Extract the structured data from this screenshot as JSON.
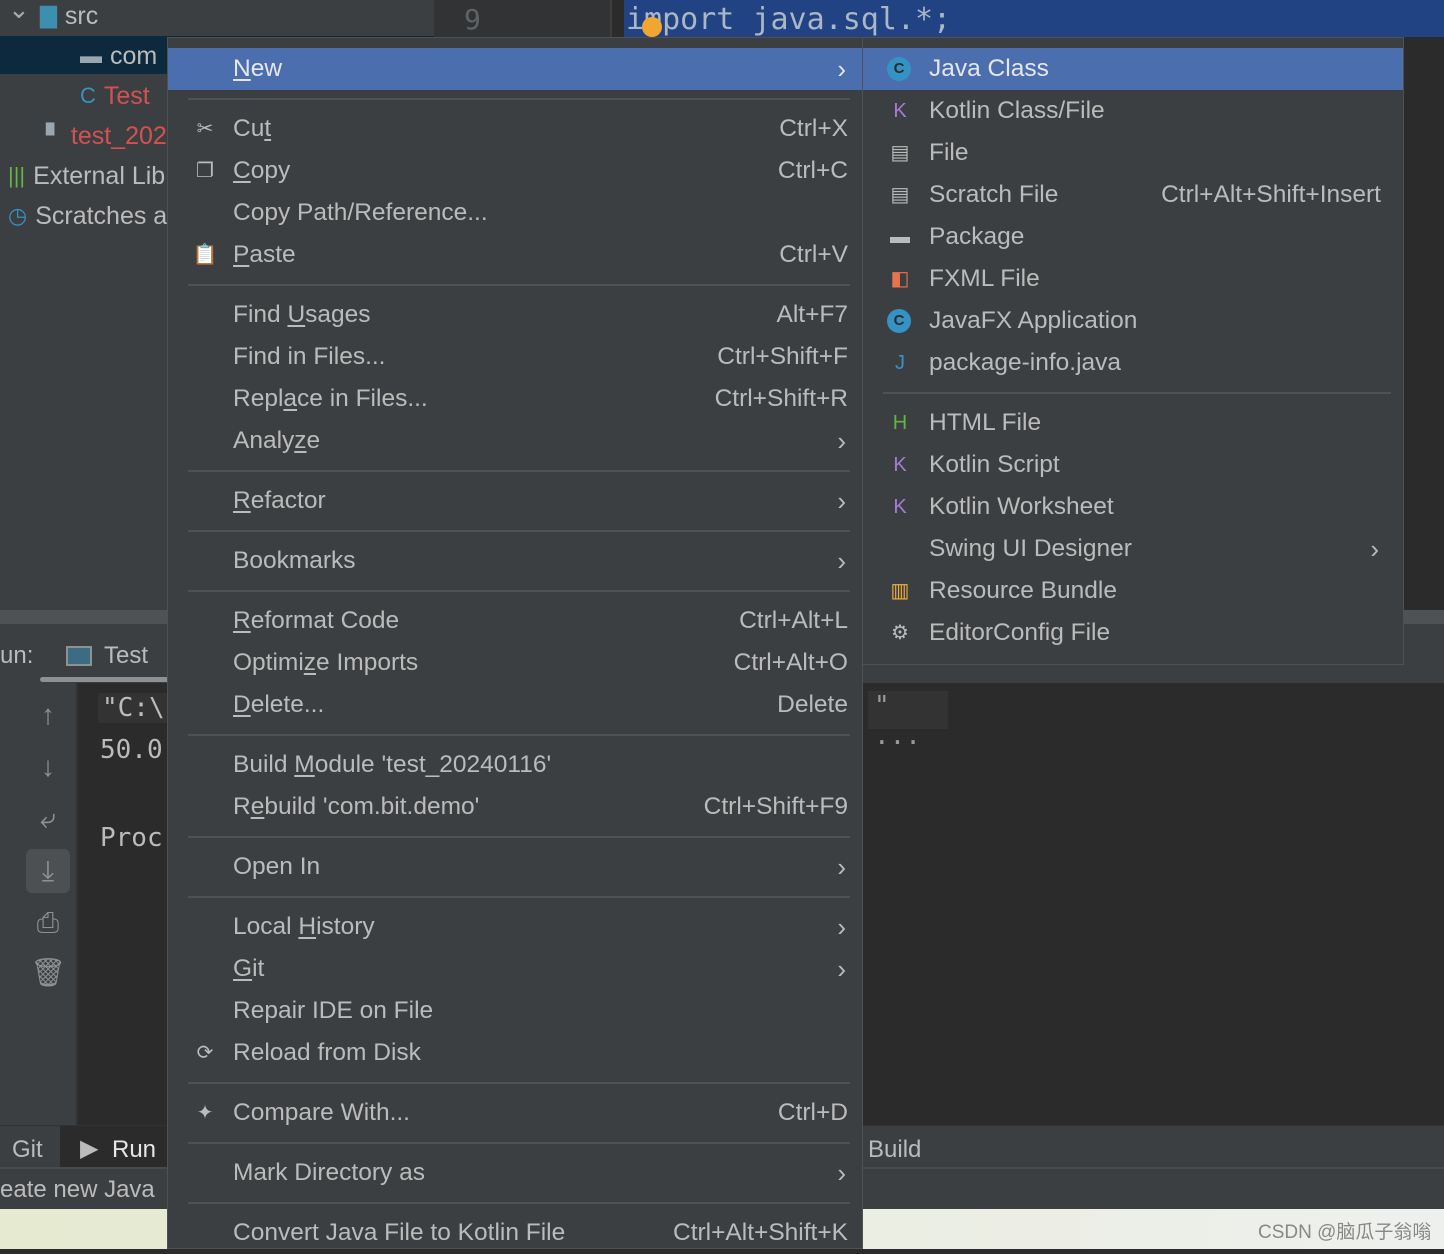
{
  "project_tree": {
    "items": [
      {
        "label": "src",
        "color": "#bbbbbb",
        "icon": "folder-icon"
      },
      {
        "label": "com",
        "color": "#bbbbbb",
        "icon": "package-icon"
      },
      {
        "label": "Test",
        "color": "#d25252",
        "icon": "java-class-icon"
      },
      {
        "label": "test_202",
        "color": "#d25252",
        "icon": "module-file-icon"
      },
      {
        "label": "External Lib",
        "color": "#bbbbbb",
        "icon": "library-icon"
      },
      {
        "label": "Scratches a",
        "color": "#bbbbbb",
        "icon": "scratches-icon"
      }
    ]
  },
  "editor": {
    "line_number": "9",
    "code_line": "import java.sql.*;"
  },
  "run_panel": {
    "label": "un:",
    "tab": "Test",
    "console_lines": [
      "\"C:\\",
      "50.0",
      "Proc"
    ],
    "console_right": "\" ...",
    "tools": [
      "arrow-up-icon",
      "arrow-down-icon",
      "soft-wrap-icon",
      "scroll-to-end-icon",
      "print-icon",
      "trash-icon"
    ]
  },
  "bottom_tabs": {
    "git": "Git",
    "run": "Run",
    "build": "Build"
  },
  "status": {
    "text": "eate new Java"
  },
  "watermark": "CSDN @脑瓜子翁嗡",
  "colors": {
    "menu_bg": "#3c3f41",
    "selection": "#4b6eaf",
    "error_file": "#d25252"
  },
  "context_menu": {
    "items": [
      {
        "pre": "",
        "u": "N",
        "post": "ew",
        "submenu": true,
        "selected": true
      },
      {
        "sep": true
      },
      {
        "pre": "Cu",
        "u": "t",
        "post": "",
        "shortcut": "Ctrl+X",
        "icon": "scissors-icon"
      },
      {
        "pre": "",
        "u": "C",
        "post": "opy",
        "shortcut": "Ctrl+C",
        "icon": "copy-icon"
      },
      {
        "pre": "Copy Path/Reference...",
        "u": "",
        "post": ""
      },
      {
        "pre": "",
        "u": "P",
        "post": "aste",
        "shortcut": "Ctrl+V",
        "icon": "clipboard-icon"
      },
      {
        "sep": true
      },
      {
        "pre": "Find ",
        "u": "U",
        "post": "sages",
        "shortcut": "Alt+F7"
      },
      {
        "pre": "Find in Files...",
        "u": "",
        "post": "",
        "shortcut": "Ctrl+Shift+F"
      },
      {
        "pre": "Repl",
        "u": "a",
        "post": "ce in Files...",
        "shortcut": "Ctrl+Shift+R"
      },
      {
        "pre": "Analy",
        "u": "z",
        "post": "e",
        "submenu": true
      },
      {
        "sep": true
      },
      {
        "pre": "",
        "u": "R",
        "post": "efactor",
        "submenu": true
      },
      {
        "sep": true
      },
      {
        "pre": "Bookmarks",
        "u": "",
        "post": "",
        "submenu": true
      },
      {
        "sep": true
      },
      {
        "pre": "",
        "u": "R",
        "post": "eformat Code",
        "shortcut": "Ctrl+Alt+L"
      },
      {
        "pre": "Optimi",
        "u": "z",
        "post": "e Imports",
        "shortcut": "Ctrl+Alt+O"
      },
      {
        "pre": "",
        "u": "D",
        "post": "elete...",
        "shortcut": "Delete"
      },
      {
        "sep": true
      },
      {
        "pre": "Build ",
        "u": "M",
        "post": "odule 'test_20240116'"
      },
      {
        "pre": "R",
        "u": "e",
        "post": "build 'com.bit.demo'",
        "shortcut": "Ctrl+Shift+F9"
      },
      {
        "sep": true
      },
      {
        "pre": "Open In",
        "u": "",
        "post": "",
        "submenu": true
      },
      {
        "sep": true
      },
      {
        "pre": "Local ",
        "u": "H",
        "post": "istory",
        "submenu": true
      },
      {
        "pre": "",
        "u": "G",
        "post": "it",
        "submenu": true
      },
      {
        "pre": "Repair IDE on File",
        "u": "",
        "post": ""
      },
      {
        "pre": "Reload from Disk",
        "u": "",
        "post": "",
        "icon": "reload-icon"
      },
      {
        "sep": true
      },
      {
        "pre": "Compare With...",
        "u": "",
        "post": "",
        "shortcut": "Ctrl+D",
        "icon": "compare-icon"
      },
      {
        "sep": true
      },
      {
        "pre": "Mark Directory as",
        "u": "",
        "post": "",
        "submenu": true
      },
      {
        "sep": true
      },
      {
        "pre": "Convert Java File to Kotlin File",
        "u": "",
        "post": "",
        "shortcut": "Ctrl+Alt+Shift+K"
      }
    ]
  },
  "new_submenu": {
    "items": [
      {
        "pre": "Java Class",
        "icon": "java-class-icon",
        "selected": true
      },
      {
        "pre": "Kotlin Class/File",
        "icon": "kotlin-file-icon"
      },
      {
        "pre": "File",
        "icon": "file-icon"
      },
      {
        "pre": "Scratch File",
        "icon": "scratch-file-icon",
        "shortcut": "Ctrl+Alt+Shift+Insert"
      },
      {
        "pre": "Package",
        "icon": "package-icon"
      },
      {
        "pre": "FXML File",
        "icon": "fxml-file-icon"
      },
      {
        "pre": "JavaFX Application",
        "icon": "javafx-class-icon"
      },
      {
        "pre": "package-info.java",
        "icon": "package-info-icon"
      },
      {
        "sep": true
      },
      {
        "pre": "HTML File",
        "icon": "html-file-icon"
      },
      {
        "pre": "Kotlin Script",
        "icon": "kotlin-script-icon"
      },
      {
        "pre": "Kotlin Worksheet",
        "icon": "kotlin-worksheet-icon"
      },
      {
        "pre": "Swing UI Designer",
        "submenu": true
      },
      {
        "pre": "Resource Bundle",
        "icon": "resource-bundle-icon"
      },
      {
        "pre": "EditorConfig File",
        "icon": "gear-icon"
      }
    ]
  }
}
